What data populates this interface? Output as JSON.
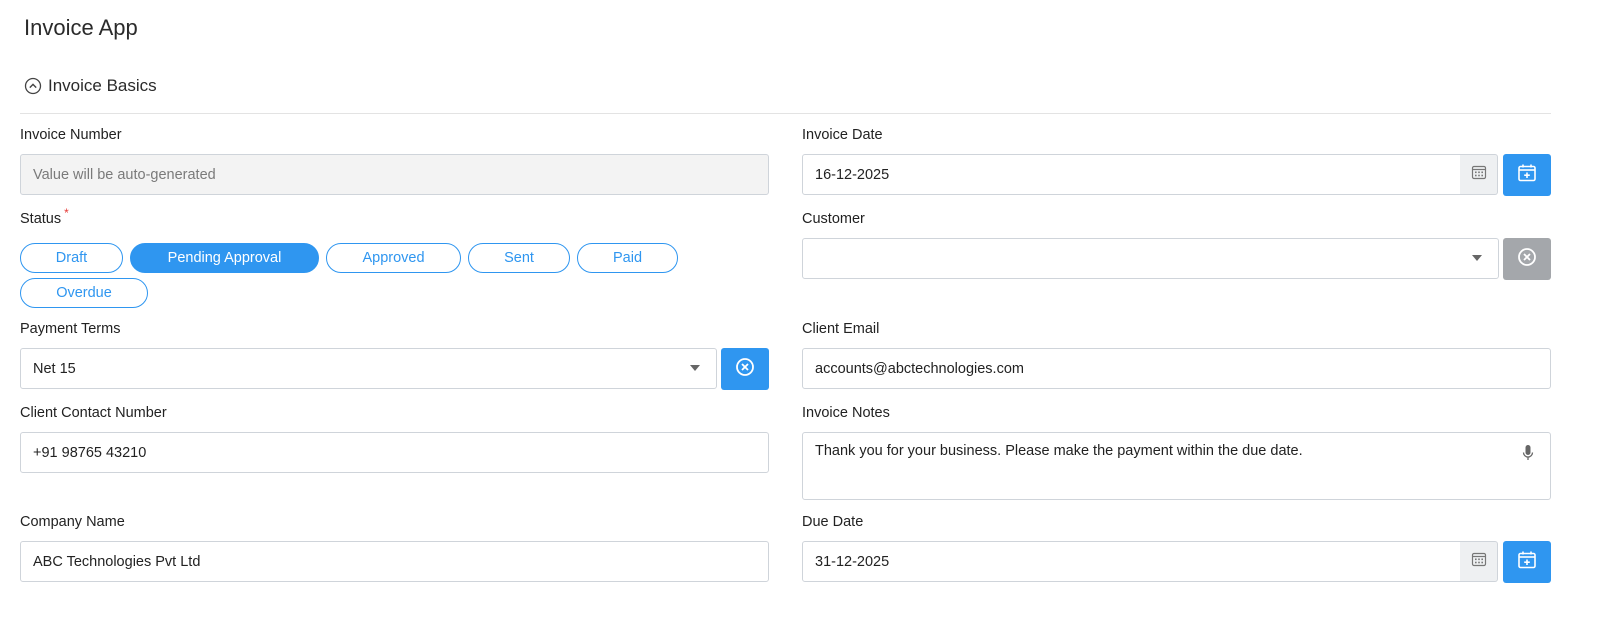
{
  "app": {
    "title": "Invoice App"
  },
  "section": {
    "title": "Invoice Basics"
  },
  "fields": {
    "invoice_number": {
      "label": "Invoice Number",
      "placeholder": "Value will be auto-generated"
    },
    "invoice_date": {
      "label": "Invoice Date",
      "value": "16-12-2025"
    },
    "status": {
      "label": "Status",
      "required_mark": "*",
      "options": [
        "Draft",
        "Pending Approval",
        "Approved",
        "Sent",
        "Paid",
        "Overdue"
      ],
      "selected": "Pending Approval"
    },
    "customer": {
      "label": "Customer",
      "value": ""
    },
    "payment_terms": {
      "label": "Payment Terms",
      "value": "Net 15"
    },
    "client_email": {
      "label": "Client Email",
      "value": "accounts@abctechnologies.com"
    },
    "client_contact": {
      "label": "Client Contact Number",
      "value": "+91 98765 43210"
    },
    "invoice_notes": {
      "label": "Invoice Notes",
      "value": "Thank you for your business. Please make the payment within the due date."
    },
    "company_name": {
      "label": "Company Name",
      "value": "ABC Technologies Pvt Ltd"
    },
    "due_date": {
      "label": "Due Date",
      "value": "31-12-2025"
    }
  },
  "icons": {
    "collapse": "chevron-up-circle-icon",
    "calendar": "calendar-icon",
    "add_date": "calendar-plus-icon",
    "clear": "close-circle-icon",
    "microphone": "microphone-icon",
    "dropdown": "caret-down-icon"
  },
  "colors": {
    "accent": "#2f96f0",
    "required": "#e53935",
    "disabled_button": "#a4a7ab",
    "disabled_field": "#f3f3f3"
  }
}
